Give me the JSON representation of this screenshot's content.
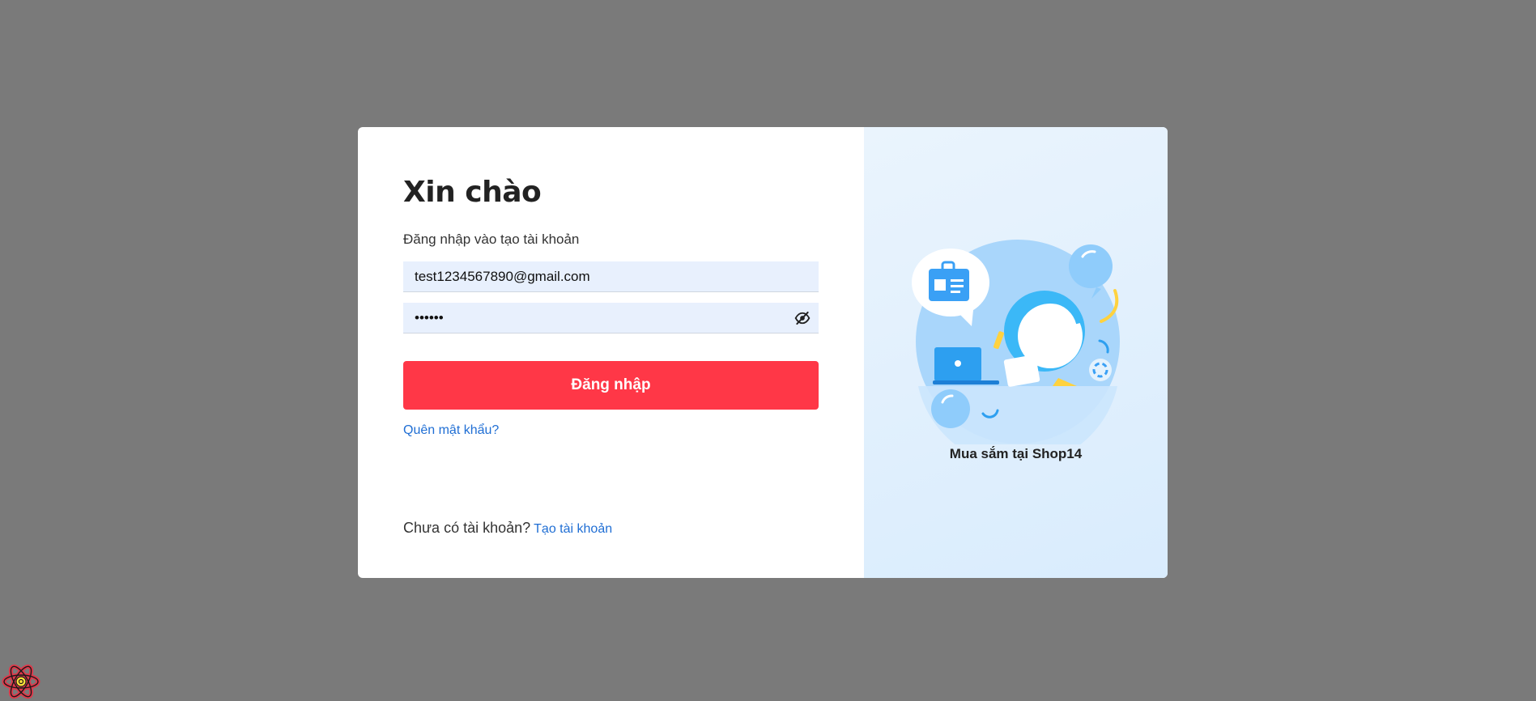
{
  "login": {
    "title": "Xin chào",
    "subtitle": "Đăng nhập vào tạo tài khoản",
    "email_value": "test1234567890@gmail.com",
    "password_value": "123456",
    "login_button": "Đăng nhập",
    "forgot_link": "Quên mật khẩu?",
    "signup_prompt": "Chưa có tài khoản?",
    "signup_link": "Tạo tài khoản"
  },
  "promo": {
    "caption": "Mua sắm tại Shop14"
  },
  "icons": {
    "password_toggle": "eye-slash-icon",
    "devtools": "react-icon"
  },
  "colors": {
    "overlay": "#7a7a7a",
    "primary_button": "#ff3747",
    "link": "#1f6ed4",
    "input_bg": "#e8f0fd"
  }
}
